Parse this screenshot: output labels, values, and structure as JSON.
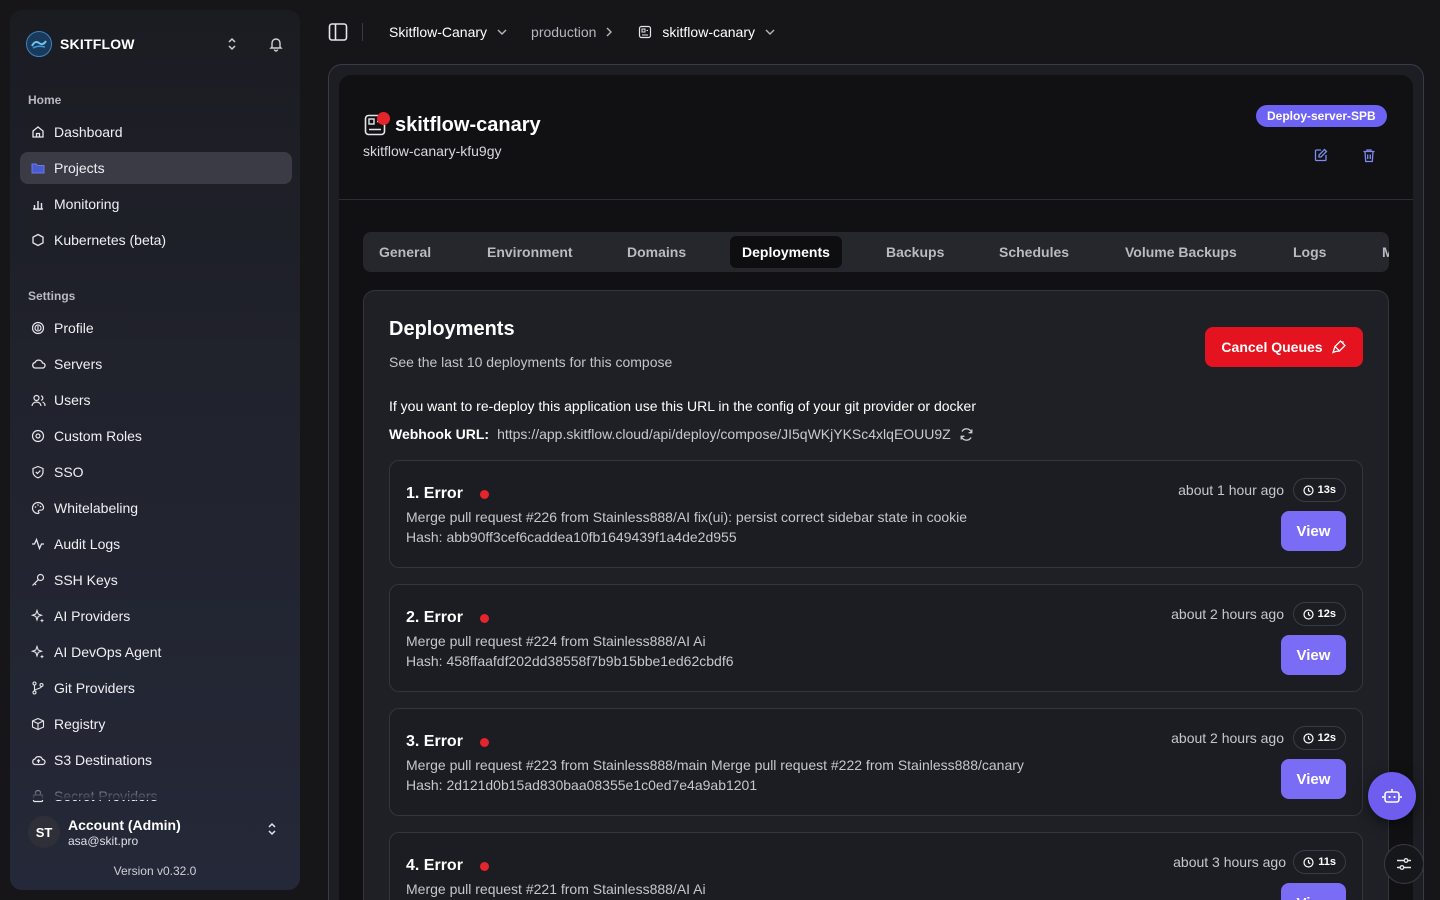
{
  "sidebar": {
    "brand": "SKITFLOW",
    "home_label": "Home",
    "home_items": [
      {
        "label": "Dashboard",
        "icon": "home-icon"
      },
      {
        "label": "Projects",
        "icon": "folder-icon",
        "active": true
      },
      {
        "label": "Monitoring",
        "icon": "bar-chart-icon"
      },
      {
        "label": "Kubernetes (beta)",
        "icon": "hexagon-icon"
      }
    ],
    "settings_label": "Settings",
    "settings_items": [
      {
        "label": "Profile",
        "icon": "fingerprint-icon"
      },
      {
        "label": "Servers",
        "icon": "cloud-icon"
      },
      {
        "label": "Users",
        "icon": "users-icon"
      },
      {
        "label": "Custom Roles",
        "icon": "shield-settings-icon"
      },
      {
        "label": "SSO",
        "icon": "shield-check-icon"
      },
      {
        "label": "Whitelabeling",
        "icon": "palette-icon"
      },
      {
        "label": "Audit Logs",
        "icon": "activity-icon"
      },
      {
        "label": "SSH Keys",
        "icon": "key-icon"
      },
      {
        "label": "AI Providers",
        "icon": "sparkles-icon"
      },
      {
        "label": "AI DevOps Agent",
        "icon": "sparkles-icon"
      },
      {
        "label": "Git Providers",
        "icon": "git-branch-icon"
      },
      {
        "label": "Registry",
        "icon": "package-icon"
      },
      {
        "label": "S3 Destinations",
        "icon": "cloud-upload-icon"
      },
      {
        "label": "Secret Providers",
        "icon": "lock-icon"
      }
    ],
    "account": {
      "initials": "ST",
      "name": "Account (Admin)",
      "email": "asa@skit.pro"
    },
    "version": "Version v0.32.0"
  },
  "breadcrumb": {
    "project": "Skitflow-Canary",
    "environment": "production",
    "service": "skitflow-canary"
  },
  "service": {
    "title": "skitflow-canary",
    "app_name": "skitflow-canary-kfu9gy",
    "server_badge": "Deploy-server-SPB"
  },
  "tabs": [
    {
      "label": "General"
    },
    {
      "label": "Environment"
    },
    {
      "label": "Domains"
    },
    {
      "label": "Deployments",
      "active": true
    },
    {
      "label": "Backups"
    },
    {
      "label": "Schedules"
    },
    {
      "label": "Volume Backups"
    },
    {
      "label": "Logs"
    },
    {
      "label": "M"
    }
  ],
  "deployments": {
    "title": "Deployments",
    "subtitle": "See the last 10 deployments for this compose",
    "cancel_label": "Cancel Queues",
    "redeploy_note": "If you want to re-deploy this application use this URL in the config of your git provider or docker",
    "webhook_label": "Webhook URL:",
    "webhook_url": "https://app.skitflow.cloud/api/deploy/compose/JI5qWKjYKSc4xlqEOUU9Z",
    "view_label": "View",
    "items": [
      {
        "name": "1. Error",
        "message": "Merge pull request #226 from Stainless888/AI fix(ui): persist correct sidebar state in cookie",
        "hash": "Hash: abb90ff3cef6caddea10fb1649439f1a4de2d955",
        "time": "about 1 hour ago",
        "duration": "13s"
      },
      {
        "name": "2. Error",
        "message": "Merge pull request #224 from Stainless888/AI Ai",
        "hash": "Hash: 458ffaafdf202dd38558f7b9b15bbe1ed62cbdf6",
        "time": "about 2 hours ago",
        "duration": "12s"
      },
      {
        "name": "3. Error",
        "message": "Merge pull request #223 from Stainless888/main Merge pull request #222 from Stainless888/canary",
        "hash": "Hash: 2d121d0b15ad830baa08355e1c0ed7e4a9ab1201",
        "time": "about 2 hours ago",
        "duration": "12s"
      },
      {
        "name": "4. Error",
        "message": "Merge pull request #221 from Stainless888/AI Ai",
        "hash": "",
        "time": "about 3 hours ago",
        "duration": "11s"
      }
    ]
  },
  "colors": {
    "accent": "#7b6cf6",
    "danger": "#e5131f",
    "status_error": "#e5242b",
    "badge": "#6c63f5"
  }
}
